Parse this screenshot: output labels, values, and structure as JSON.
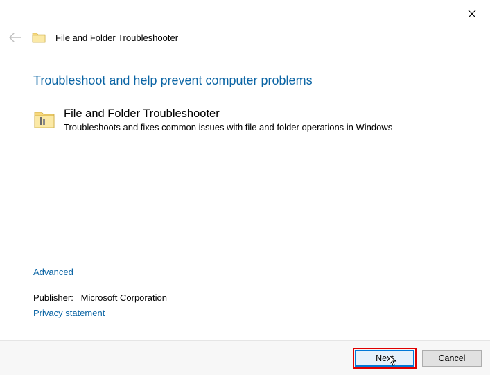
{
  "titlebar": {
    "app_title": "File and Folder Troubleshooter"
  },
  "main": {
    "heading": "Troubleshoot and help prevent computer problems",
    "tool_name": "File and Folder Troubleshooter",
    "tool_desc": "Troubleshoots and fixes common issues with file and folder operations in Windows"
  },
  "links": {
    "advanced": "Advanced",
    "privacy": "Privacy statement"
  },
  "publisher": {
    "label": "Publisher:",
    "value": "Microsoft Corporation"
  },
  "buttons": {
    "next": "Next",
    "cancel": "Cancel"
  }
}
